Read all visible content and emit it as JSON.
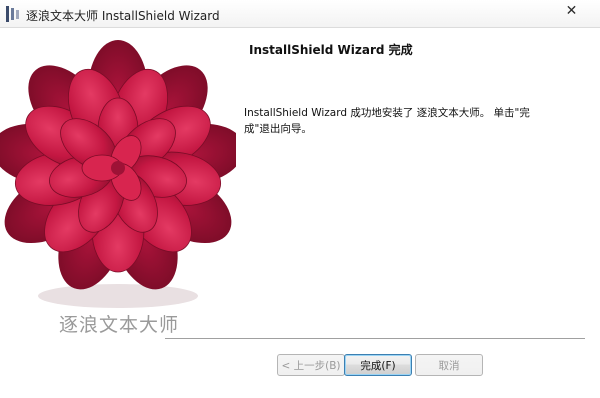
{
  "window": {
    "title": "逐浪文本大师 InstallShield Wizard",
    "close_glyph": "✕"
  },
  "sidebar": {
    "product_name": "逐浪文本大师",
    "flower_color": "#c21a43"
  },
  "content": {
    "heading": "InstallShield Wizard 完成",
    "message": "InstallShield Wizard 成功地安装了 逐浪文本大师。 单击\"完成\"退出向导。"
  },
  "buttons": {
    "back_label": "< 上一步(B)",
    "finish_label": "完成(F)",
    "cancel_label": "取消"
  }
}
